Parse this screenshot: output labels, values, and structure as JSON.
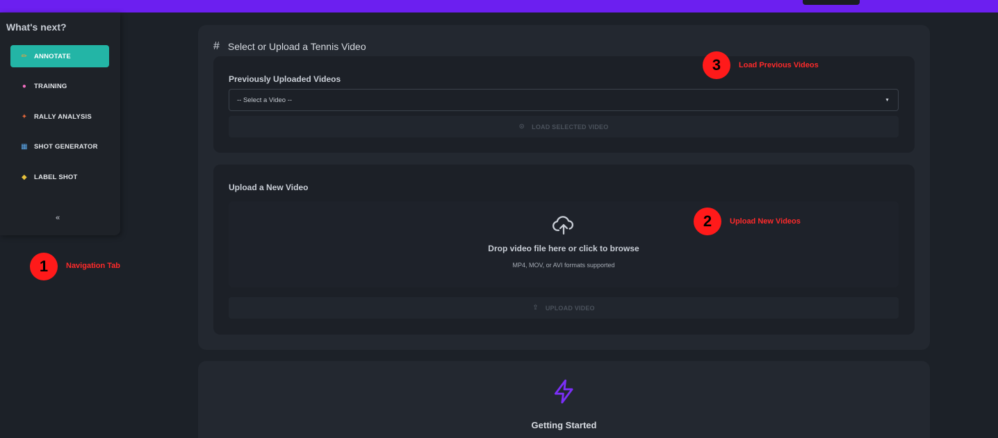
{
  "sidebar": {
    "title": "What's next?",
    "items": [
      {
        "label": "ANNOTATE",
        "icon": "pencil-icon",
        "glyph": "✏"
      },
      {
        "label": "TRAINING",
        "icon": "brain-icon",
        "glyph": "●"
      },
      {
        "label": "RALLY ANALYSIS",
        "icon": "racket-icon",
        "glyph": "✦"
      },
      {
        "label": "SHOT GENERATOR",
        "icon": "chart-icon",
        "glyph": "▦"
      },
      {
        "label": "LABEL SHOT",
        "icon": "tag-icon",
        "glyph": "◆"
      }
    ],
    "collapse_glyph": "«"
  },
  "markers": [
    {
      "number": "1",
      "label": "Navigation Tab"
    },
    {
      "number": "2",
      "label": "Upload New Videos"
    },
    {
      "number": "3",
      "label": "Load Previous Videos"
    }
  ],
  "main": {
    "title": "Select or Upload a Tennis Video",
    "title_glyph": "#",
    "previous": {
      "label": "Previously Uploaded Videos",
      "select_value": "-- Select a Video --",
      "caret_glyph": "▼",
      "load_button": "LOAD SELECTED VIDEO",
      "load_icon_glyph": "⊙"
    },
    "upload": {
      "label": "Upload a New Video",
      "drop_text": "Drop video file here or click to browse",
      "formats_text": "MP4, MOV, or AVI formats supported",
      "upload_button": "UPLOAD VIDEO",
      "upload_icon_glyph": "⇪"
    }
  },
  "getting_started": {
    "title": "Getting Started"
  },
  "colors": {
    "topbar": "#6c1ff0",
    "active_nav": "#23b5a6",
    "marker": "#ff1a1a",
    "bolt": "#7b2ff7"
  }
}
